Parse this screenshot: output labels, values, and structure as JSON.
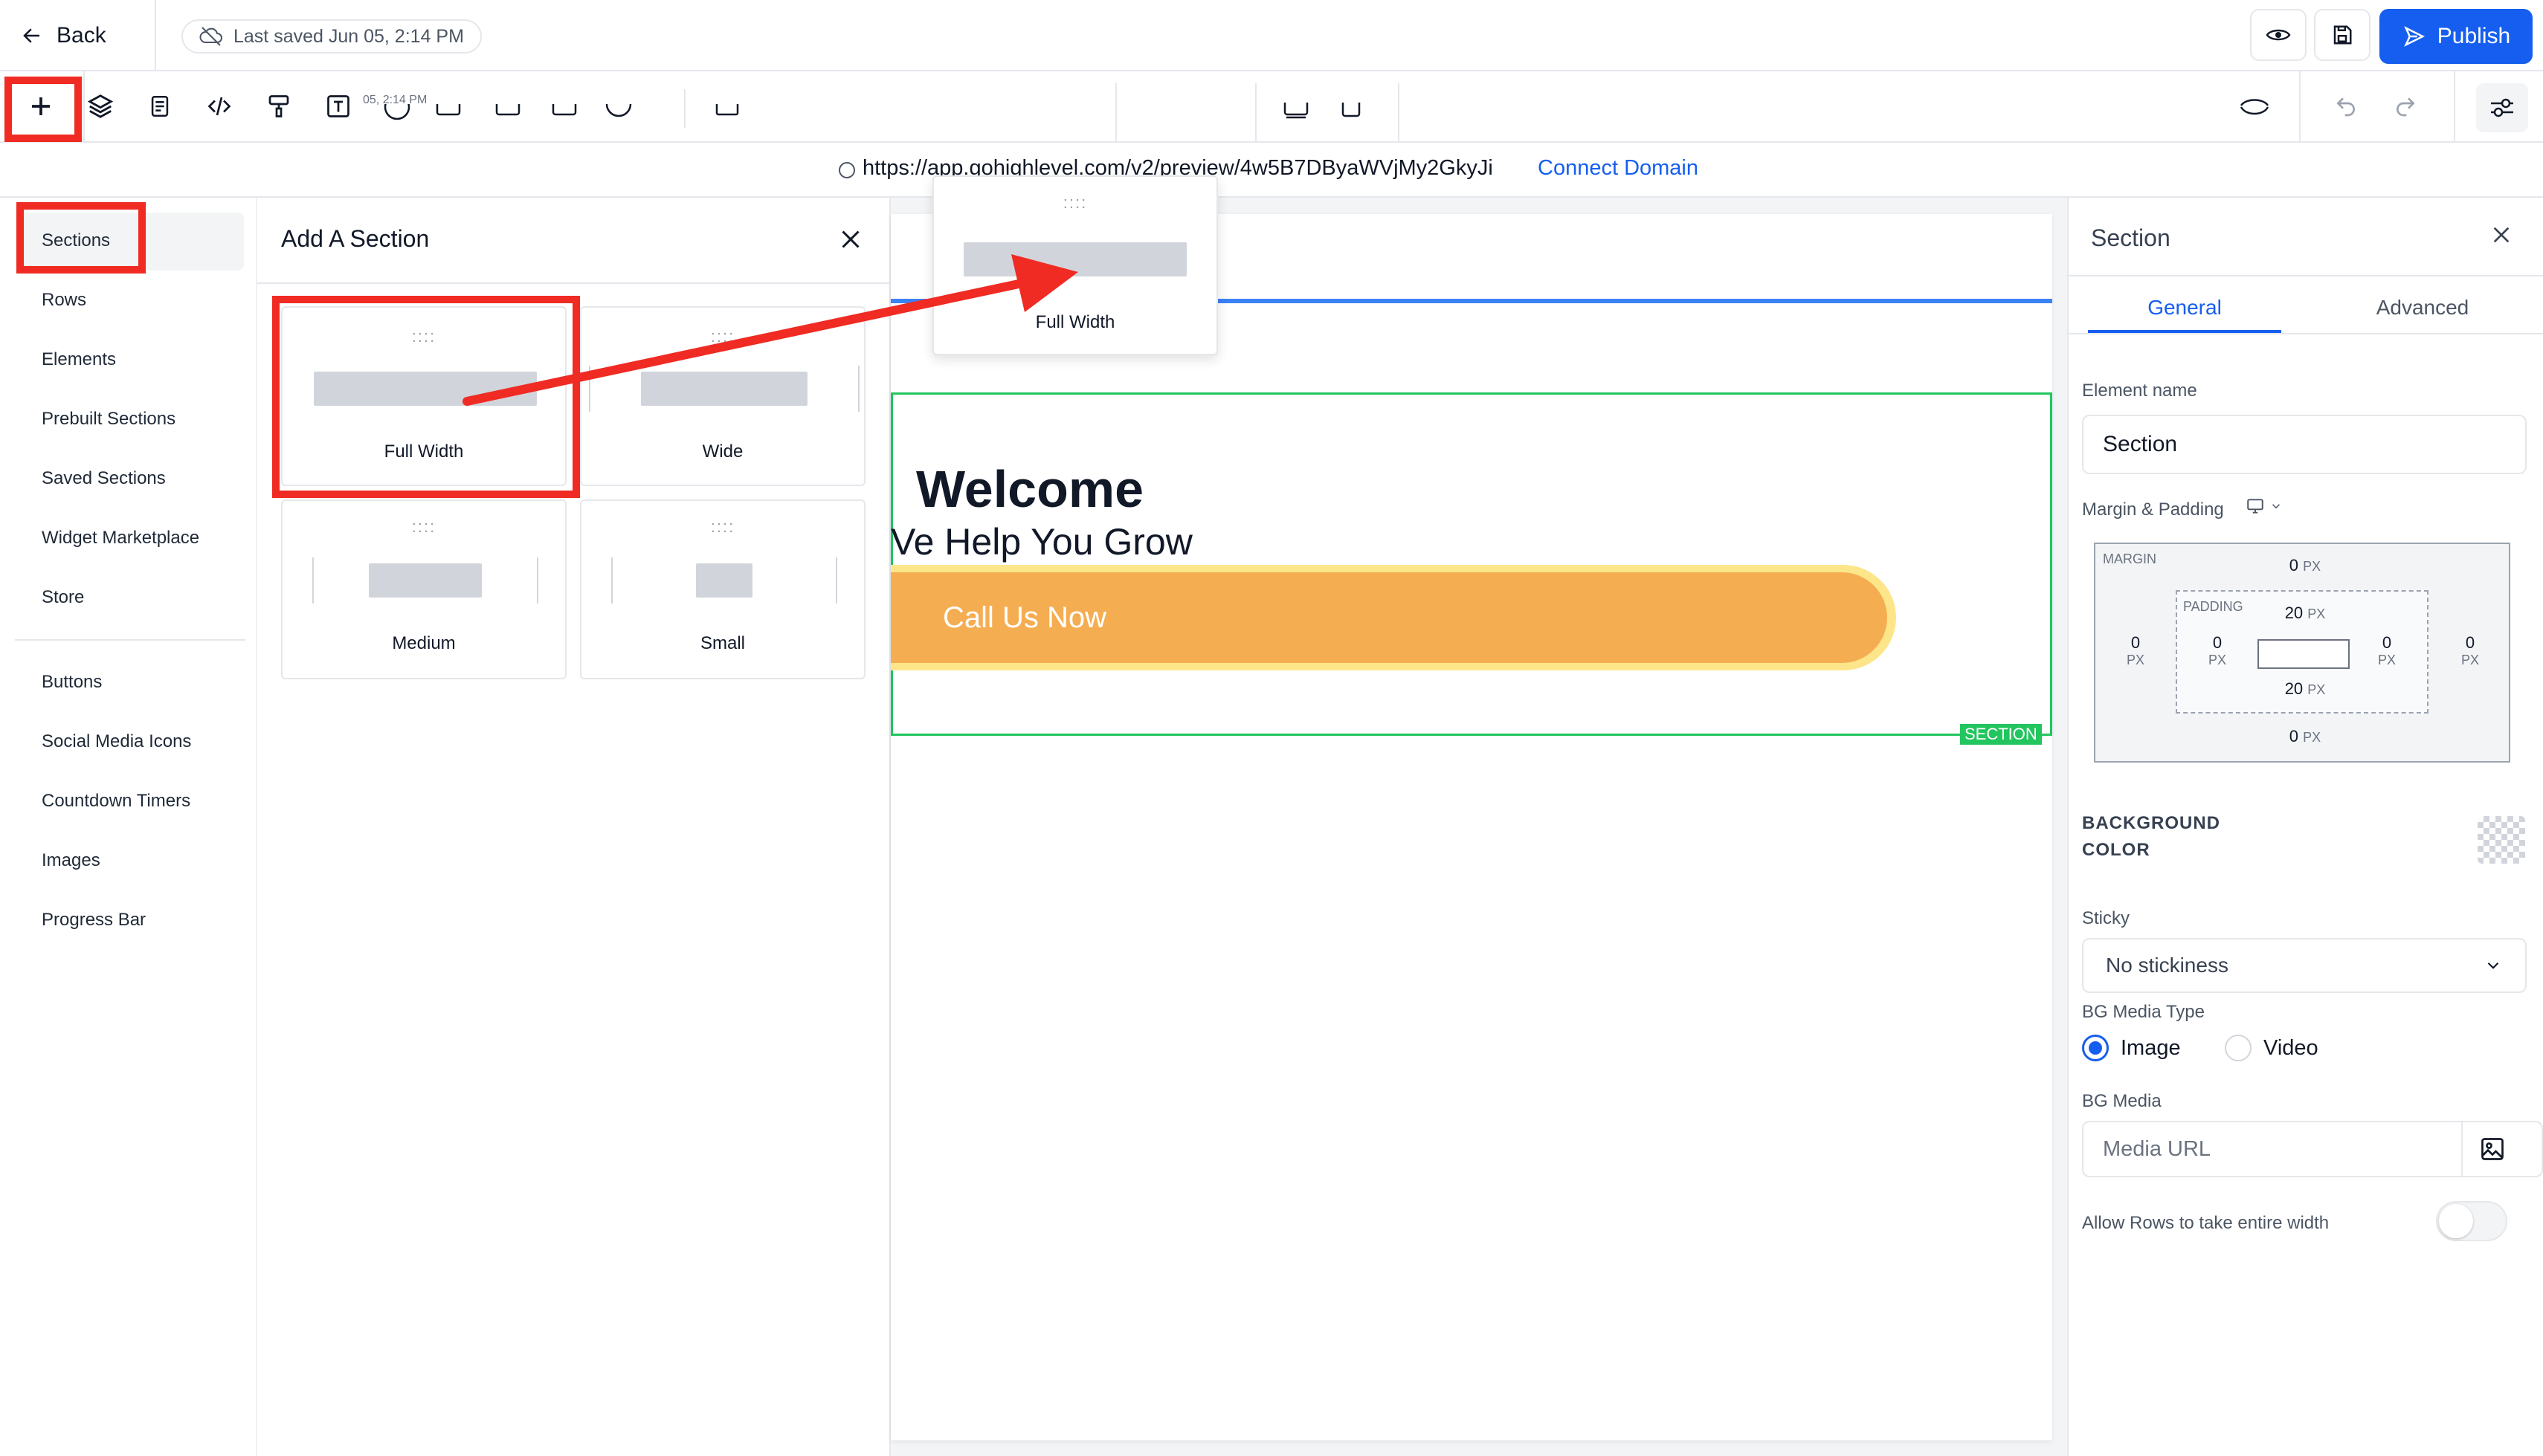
{
  "topbar": {
    "back_label": "Back",
    "saved_label": "Last saved Jun 05, 2:14 PM",
    "publish_label": "Publish",
    "behind_text": "05, 2:14 PM"
  },
  "url": {
    "address": "https://app.gohighlevel.com/v2/preview/4w5B7DByaWVjMy2GkyJi",
    "connect_label": "Connect Domain"
  },
  "leftnav": {
    "items": [
      "Sections",
      "Rows",
      "Elements",
      "Prebuilt Sections",
      "Saved Sections",
      "Widget Marketplace",
      "Store"
    ],
    "items2": [
      "Buttons",
      "Social Media Icons",
      "Countdown Timers",
      "Images",
      "Progress Bar"
    ]
  },
  "panel": {
    "title": "Add A Section",
    "cards": [
      "Full Width",
      "Wide",
      "Medium",
      "Small"
    ],
    "drag_label": "Full Width"
  },
  "canvas": {
    "heading": "Welcome",
    "subheading": "Ve Help You Grow",
    "cta_label": "Call Us Now",
    "section_badge": "SECTION"
  },
  "right": {
    "title": "Section",
    "tabs": [
      "General",
      "Advanced"
    ],
    "element_name_label": "Element name",
    "element_name_value": "Section",
    "margin_padding_label": "Margin & Padding",
    "margin_label": "MARGIN",
    "padding_label": "PADDING",
    "margin_top": "0",
    "margin_bottom": "0",
    "margin_left": "0",
    "margin_right": "0",
    "padding_top": "20",
    "padding_bottom": "20",
    "padding_left": "0",
    "padding_right": "0",
    "unit": "PX",
    "bg_color_label_1": "BACKGROUND",
    "bg_color_label_2": "COLOR",
    "sticky_label": "Sticky",
    "sticky_value": "No stickiness",
    "bg_media_type_label": "BG Media Type",
    "media_types": [
      "Image",
      "Video"
    ],
    "bg_media_label": "BG Media",
    "media_url_placeholder": "Media URL",
    "allow_rows_label": "Allow Rows to take entire width"
  },
  "colors": {
    "accent": "#155eef",
    "annotation_red": "#ef2b23",
    "cta": "#f5ad52",
    "section_outline": "#22c55e"
  }
}
